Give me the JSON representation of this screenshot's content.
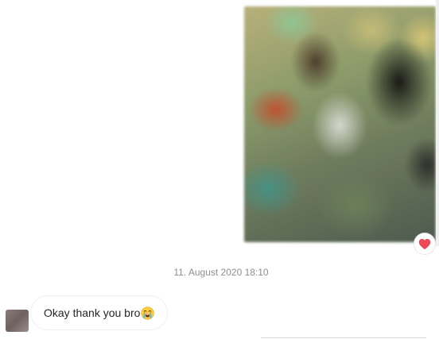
{
  "chat": {
    "sent_image": {
      "kind": "photo",
      "state": "blurred"
    },
    "reaction": {
      "icon": "heart-icon",
      "color": "#ed4956"
    },
    "timestamp": "11. August 2020 18:10",
    "received_message": {
      "text": "Okay thank you bro",
      "emoji_icon": "loudly-crying-face-icon"
    }
  },
  "colors": {
    "background": "#ffffff",
    "bubble_border": "#efefef",
    "text": "#262626",
    "timestamp_text": "#8e8e8e",
    "heart": "#ed4956"
  }
}
